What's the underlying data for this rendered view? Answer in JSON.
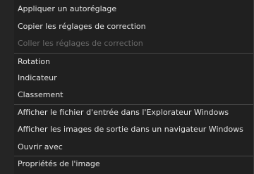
{
  "context_menu": {
    "items": [
      {
        "label": "Appliquer un autoréglage",
        "enabled": true
      },
      {
        "label": "Copier les réglages de correction",
        "enabled": true
      },
      {
        "label": "Coller les réglages de correction",
        "enabled": false
      },
      {
        "label": "Rotation",
        "enabled": true
      },
      {
        "label": "Indicateur",
        "enabled": true
      },
      {
        "label": "Classement",
        "enabled": true
      },
      {
        "label": "Afficher le fichier d'entrée dans l'Explorateur Windows",
        "enabled": true
      },
      {
        "label": "Afficher les images de sortie dans un navigateur Windows",
        "enabled": true
      },
      {
        "label": "Ouvrir avec",
        "enabled": true
      },
      {
        "label": "Propriétés de l'image",
        "enabled": true
      }
    ],
    "colors": {
      "background": "#202020",
      "text": "#e4e4e4",
      "disabled_text": "#6a6a6a",
      "separator": "#474747"
    }
  }
}
